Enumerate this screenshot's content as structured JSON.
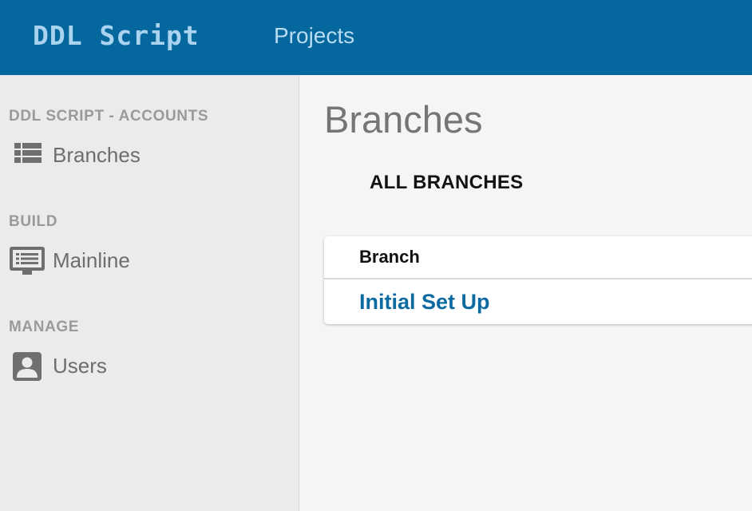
{
  "app": {
    "brand": "DDL Script"
  },
  "topnav": {
    "projects_label": "Projects"
  },
  "sidebar": {
    "sections": [
      {
        "heading": "DDL SCRIPT - ACCOUNTS",
        "items": [
          {
            "label": "Branches",
            "icon": "list-icon"
          }
        ]
      },
      {
        "heading": "BUILD",
        "items": [
          {
            "label": "Mainline",
            "icon": "monitor-icon"
          }
        ]
      },
      {
        "heading": "MANAGE",
        "items": [
          {
            "label": "Users",
            "icon": "user-icon"
          }
        ]
      }
    ]
  },
  "main": {
    "title": "Branches",
    "tab_label": "ALL BRANCHES",
    "table": {
      "column_header": "Branch",
      "rows": [
        {
          "branch": "Initial Set Up"
        }
      ]
    }
  },
  "colors": {
    "header_bg": "#04679e",
    "brand_text": "#a9d3ee",
    "link": "#0b6aa0",
    "sidebar_bg": "#ebebeb",
    "main_bg": "#f4f5f7"
  }
}
